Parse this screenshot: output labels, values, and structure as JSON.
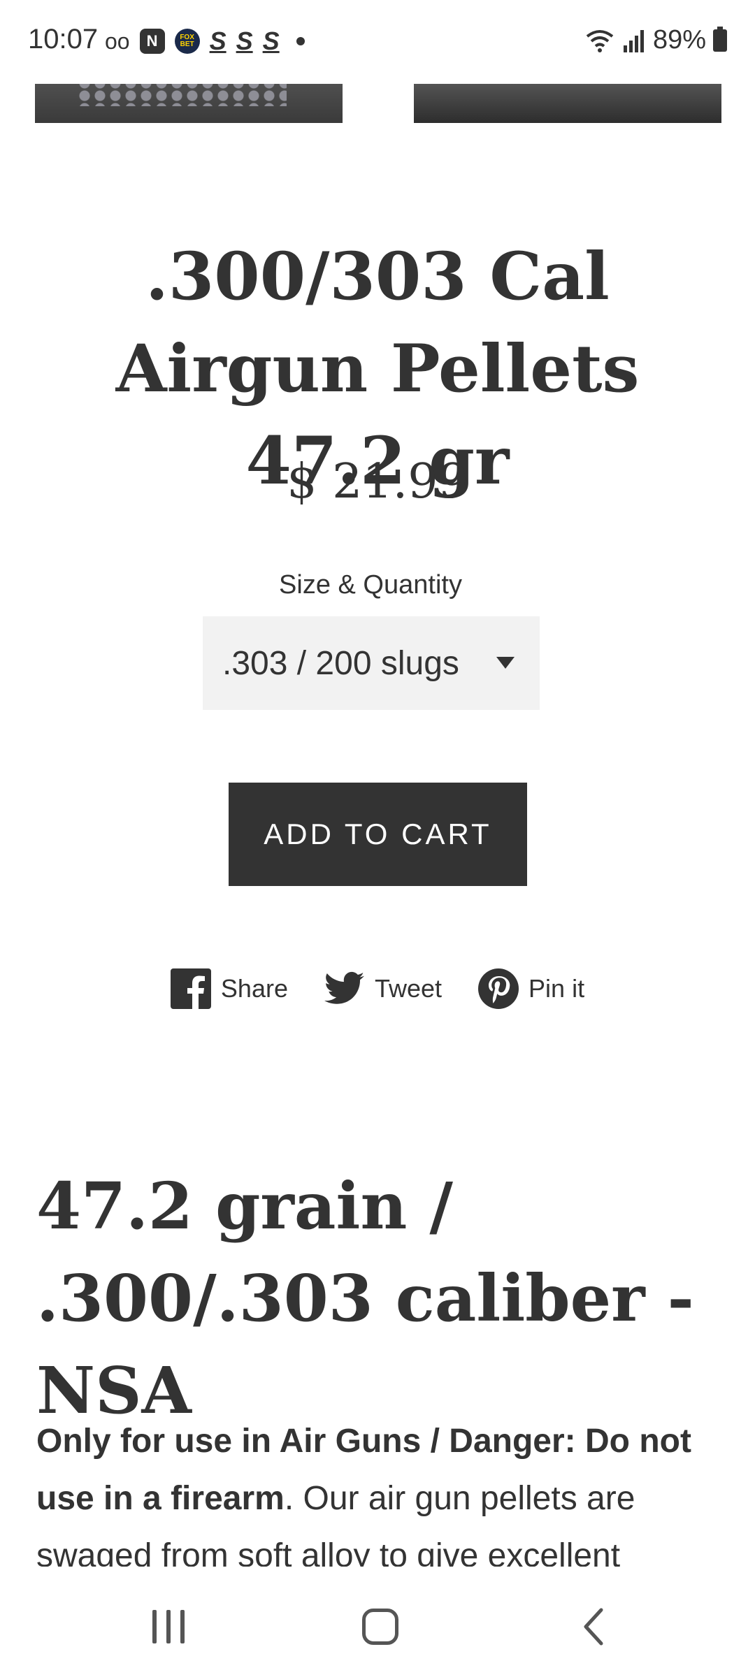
{
  "status_bar": {
    "time": "10:07",
    "voicemail_icon": "oo",
    "app_badge": "N",
    "fox_badge": "FOX BET",
    "s_icons": [
      "S",
      "S",
      "S"
    ],
    "battery": "89%"
  },
  "product": {
    "title": ".300/303 Cal Airgun Pellets 47.2 gr",
    "price": "$ 21.99",
    "variant_label": "Size & Quantity",
    "variant_selected": ".303 / 200 slugs",
    "add_to_cart": "ADD TO CART"
  },
  "share": {
    "facebook": "Share",
    "twitter": "Tweet",
    "pinterest": "Pin it"
  },
  "description": {
    "heading": "47.2 grain / .300/.303 caliber -NSA",
    "bold_text": "Only for use in Air Guns / Danger: Do not use in a firearm",
    "body_text": ". Our air gun pellets are swaged from soft alloy to give excellent"
  },
  "colors": {
    "text": "#333333",
    "button_bg": "#333333",
    "select_bg": "#f2f2f2"
  },
  "icons": [
    "wifi-icon",
    "signal-icon",
    "battery-icon",
    "facebook-icon",
    "twitter-icon",
    "pinterest-icon",
    "caret-down-icon",
    "recents-icon",
    "home-icon",
    "back-icon"
  ]
}
